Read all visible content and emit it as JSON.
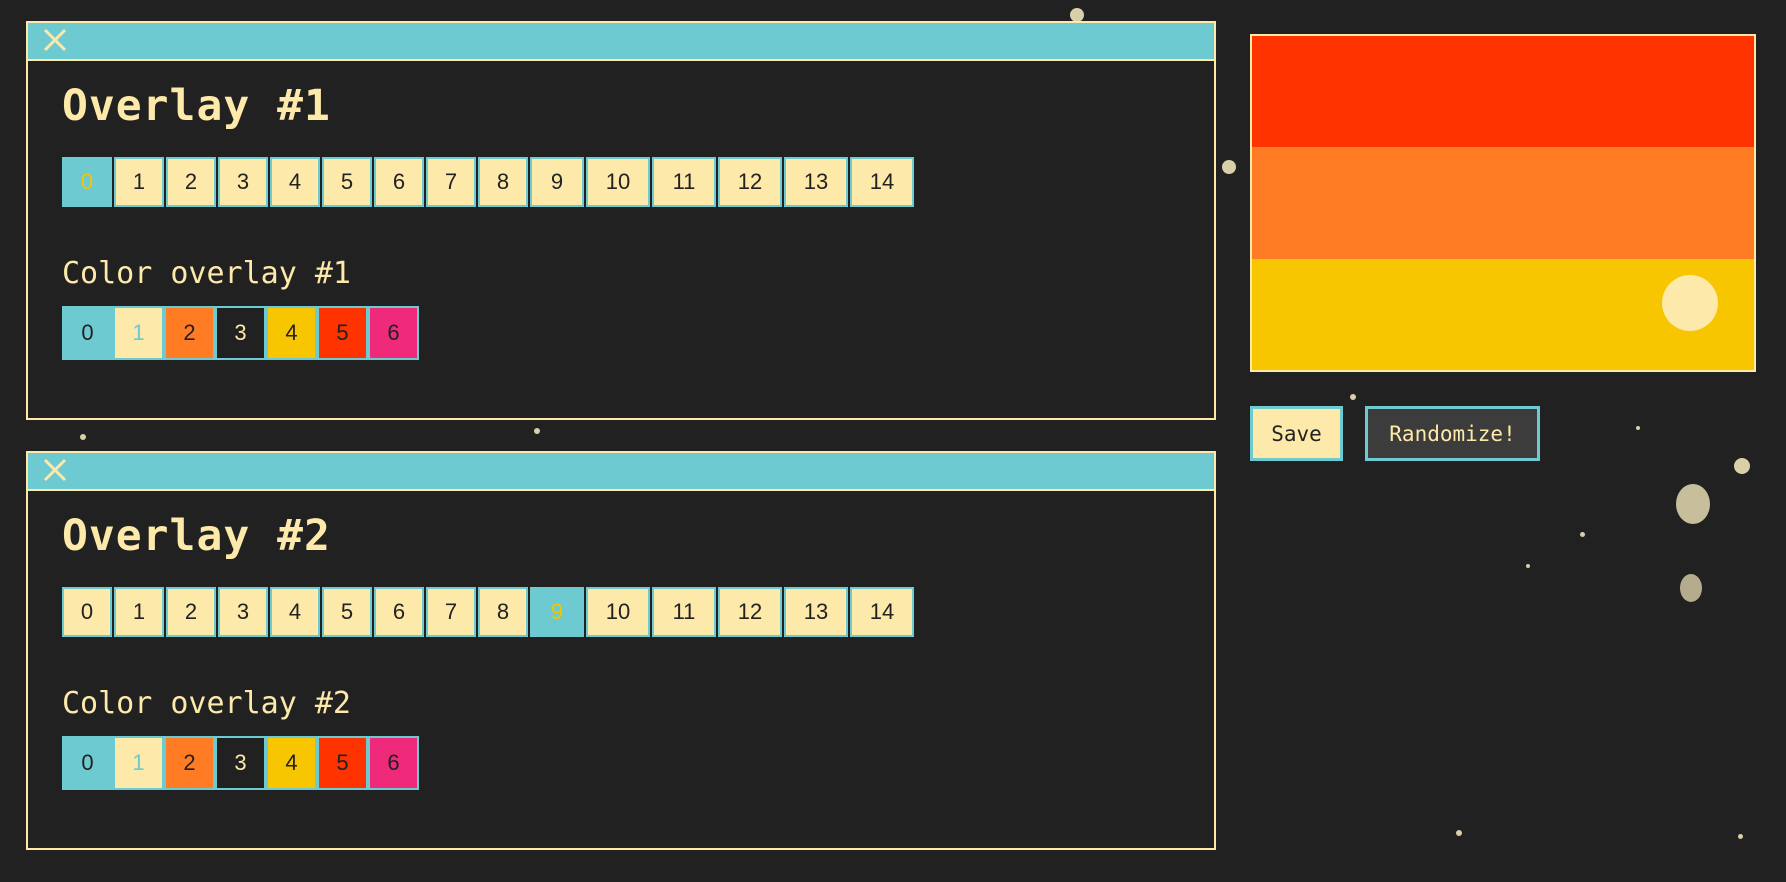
{
  "overlays": [
    {
      "title": "Overlay #1",
      "color_title": "Color overlay #1",
      "steps": [
        "0",
        "1",
        "2",
        "3",
        "4",
        "5",
        "6",
        "7",
        "8",
        "9",
        "10",
        "11",
        "12",
        "13",
        "14"
      ],
      "active_step": 0,
      "swatches": [
        "0",
        "1",
        "2",
        "3",
        "4",
        "5",
        "6"
      ]
    },
    {
      "title": "Overlay #2",
      "color_title": "Color overlay #2",
      "steps": [
        "0",
        "1",
        "2",
        "3",
        "4",
        "5",
        "6",
        "7",
        "8",
        "9",
        "10",
        "11",
        "12",
        "13",
        "14"
      ],
      "active_step": 9,
      "swatches": [
        "0",
        "1",
        "2",
        "3",
        "4",
        "5",
        "6"
      ]
    }
  ],
  "swatch_colors": [
    {
      "bg": "#6ccad0",
      "fg": "#222222"
    },
    {
      "bg": "#fde9a9",
      "fg": "#6ccad0"
    },
    {
      "bg": "#ff7b24",
      "fg": "#222222"
    },
    {
      "bg": "#212121",
      "fg": "#fde9a9"
    },
    {
      "bg": "#f7c600",
      "fg": "#222222"
    },
    {
      "bg": "#ff3300",
      "fg": "#222222"
    },
    {
      "bg": "#ef2a7b",
      "fg": "#222222"
    }
  ],
  "preview": {
    "bands": [
      "#ff3300",
      "#ff7b24",
      "#f7c600"
    ],
    "dot_color": "#fde9a9"
  },
  "buttons": {
    "save_label": "Save",
    "randomize_label": "Randomize!"
  },
  "colors": {
    "accent": "#6ccad0",
    "cream": "#fde9a9",
    "background": "#212121"
  }
}
